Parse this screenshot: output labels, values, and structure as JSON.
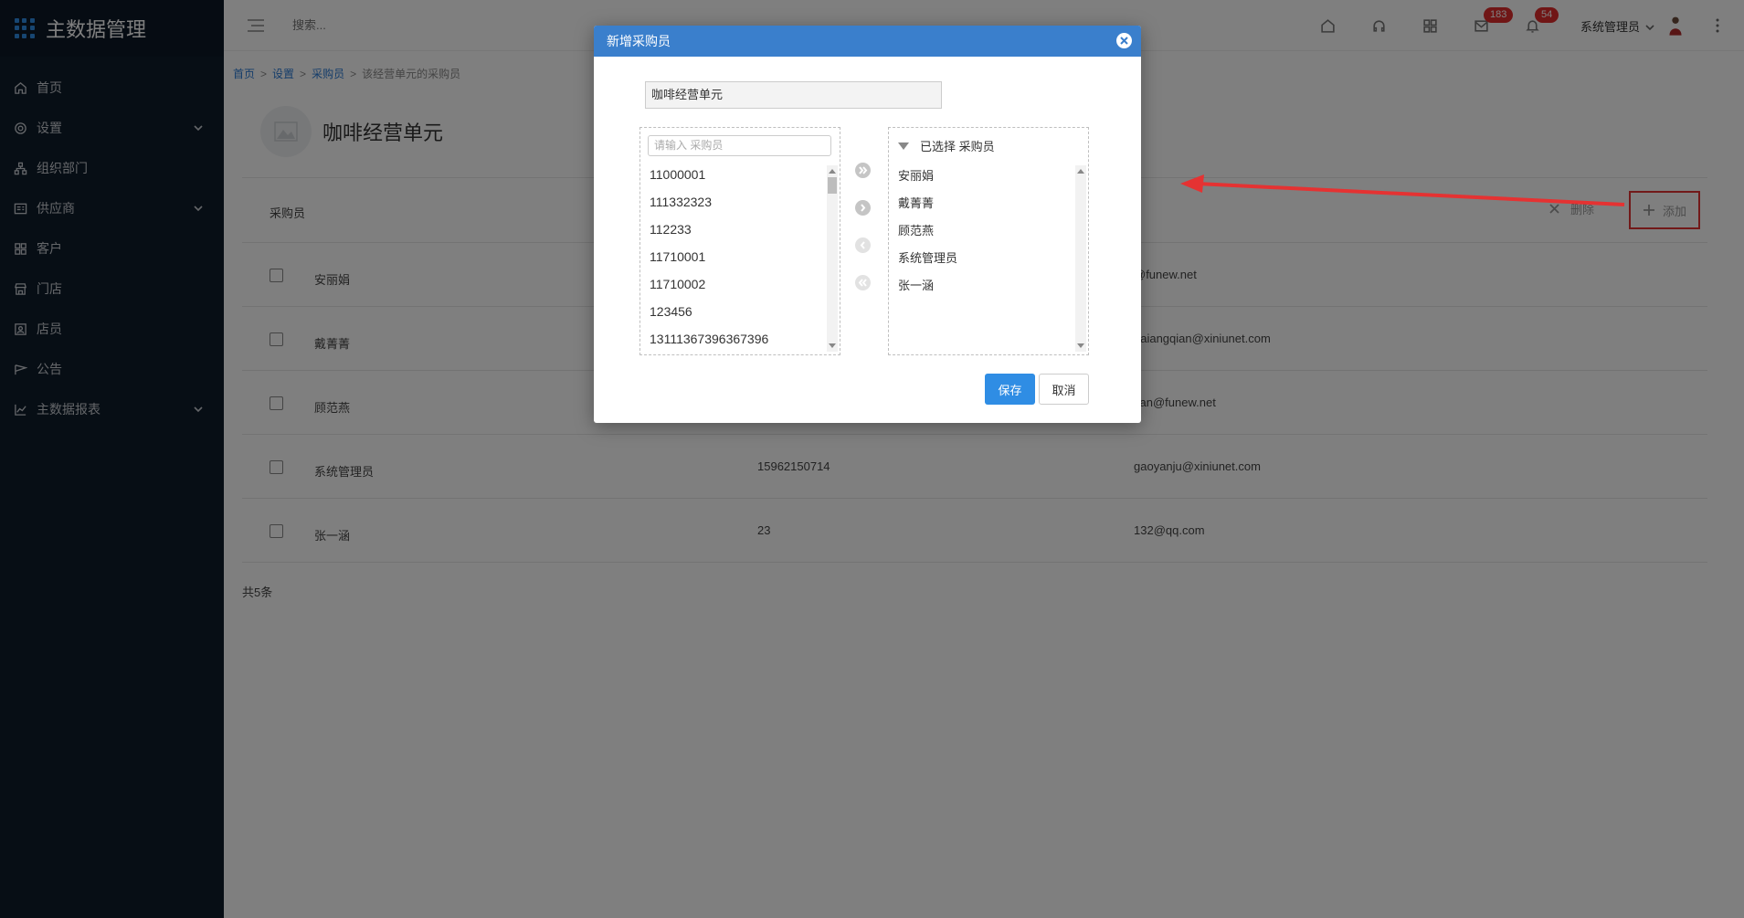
{
  "sidebar": {
    "brand": "主数据管理",
    "items": [
      {
        "label": "首页",
        "icon": "home-icon",
        "expandable": false
      },
      {
        "label": "设置",
        "icon": "gear-icon",
        "expandable": true
      },
      {
        "label": "组织部门",
        "icon": "org-chart-icon",
        "expandable": false
      },
      {
        "label": "供应商",
        "icon": "vendor-icon",
        "expandable": true
      },
      {
        "label": "客户",
        "icon": "customer-icon",
        "expandable": false
      },
      {
        "label": "门店",
        "icon": "store-icon",
        "expandable": false
      },
      {
        "label": "店员",
        "icon": "staff-icon",
        "expandable": false
      },
      {
        "label": "公告",
        "icon": "announcement-icon",
        "expandable": false
      },
      {
        "label": "主数据报表",
        "icon": "chart-icon",
        "expandable": true
      }
    ]
  },
  "topbar": {
    "search_placeholder": "搜索...",
    "badges": {
      "messages": "183",
      "notifications": "54"
    },
    "user_name": "系统管理员"
  },
  "breadcrumb": {
    "home": "首页",
    "settings": "设置",
    "buyers": "采购员",
    "current": "该经营单元的采购员"
  },
  "unit": {
    "title": "咖啡经营单元"
  },
  "table": {
    "column_title": "采购员",
    "delete_label": "删除",
    "add_label": "添加",
    "rows": [
      {
        "name": "安丽娟",
        "phone": "",
        "email": "@funew.net"
      },
      {
        "name": "戴菁菁",
        "phone": "",
        "email": "daiangqian@xiniunet.com"
      },
      {
        "name": "顾范燕",
        "phone": "",
        "email": "yan@funew.net"
      },
      {
        "name": "系统管理员",
        "phone": "15962150714",
        "email": "gaoyanju@xiniunet.com"
      },
      {
        "name": "张一涵",
        "phone": "23",
        "email": "132@qq.com"
      }
    ],
    "total": "共5条"
  },
  "dialog": {
    "title": "新增采购员",
    "unit_value": "咖啡经营单元",
    "search_placeholder": "请输入 采购员",
    "available": [
      "11000001",
      "111332323",
      "112233",
      "11710001",
      "11710002",
      "123456",
      "13111367396367396"
    ],
    "selected_title": "已选择 采购员",
    "selected": [
      "安丽娟",
      "戴菁菁",
      "顾范燕",
      "系统管理员",
      "张一涵"
    ],
    "save_label": "保存",
    "cancel_label": "取消"
  },
  "colors": {
    "sidebar_bg": "#0f1c2b",
    "dialog_header": "#3a7fcc",
    "primary_button": "#2f8de4",
    "annotation_red": "#e53232",
    "badge_red": "#e02c2c"
  }
}
